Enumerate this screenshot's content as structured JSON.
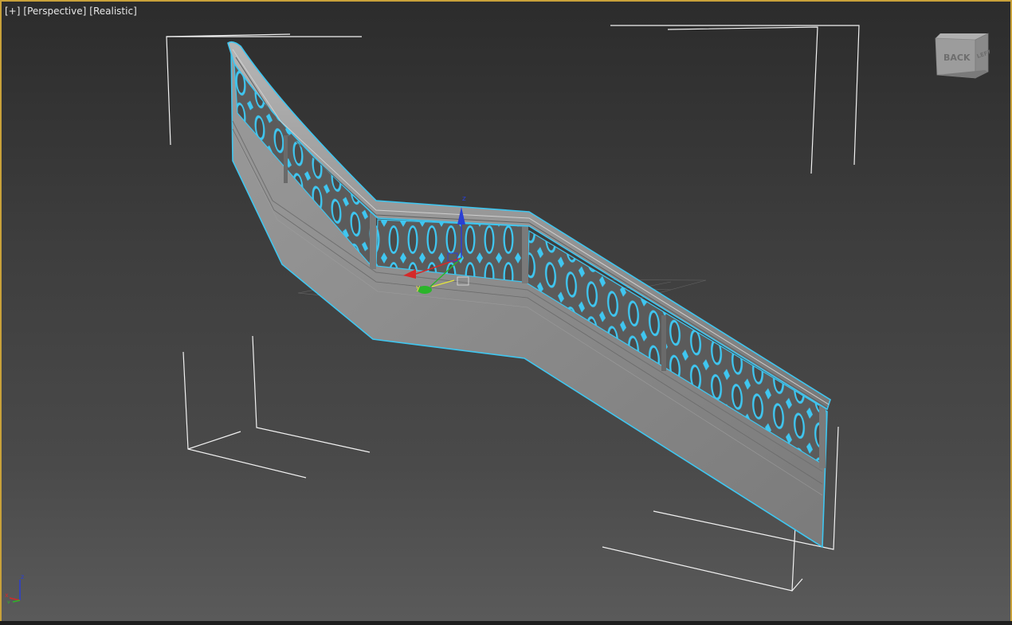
{
  "viewport": {
    "labels": {
      "menu": "[+]",
      "view": "[Perspective]",
      "shading": "[Realistic]"
    },
    "view_cube": {
      "face_back": "BACK",
      "face_left": "LEFT"
    },
    "gizmo": {
      "z_label": "z",
      "y_label": "y",
      "x_label": "x"
    },
    "tripod": {
      "z_label": "z",
      "x_label": "x",
      "y_label": "y"
    },
    "colors": {
      "border_active": "#c8a13a",
      "selection_highlight": "#3fc6f0",
      "mesh_gray": "#8c8c8c",
      "axis_x": "#d42a2a",
      "axis_y": "#2bb52b",
      "axis_z": "#2a3fd4"
    },
    "icons": [
      "viewcube-icon",
      "transform-gizmo-icon",
      "axis-tripod-icon"
    ]
  }
}
